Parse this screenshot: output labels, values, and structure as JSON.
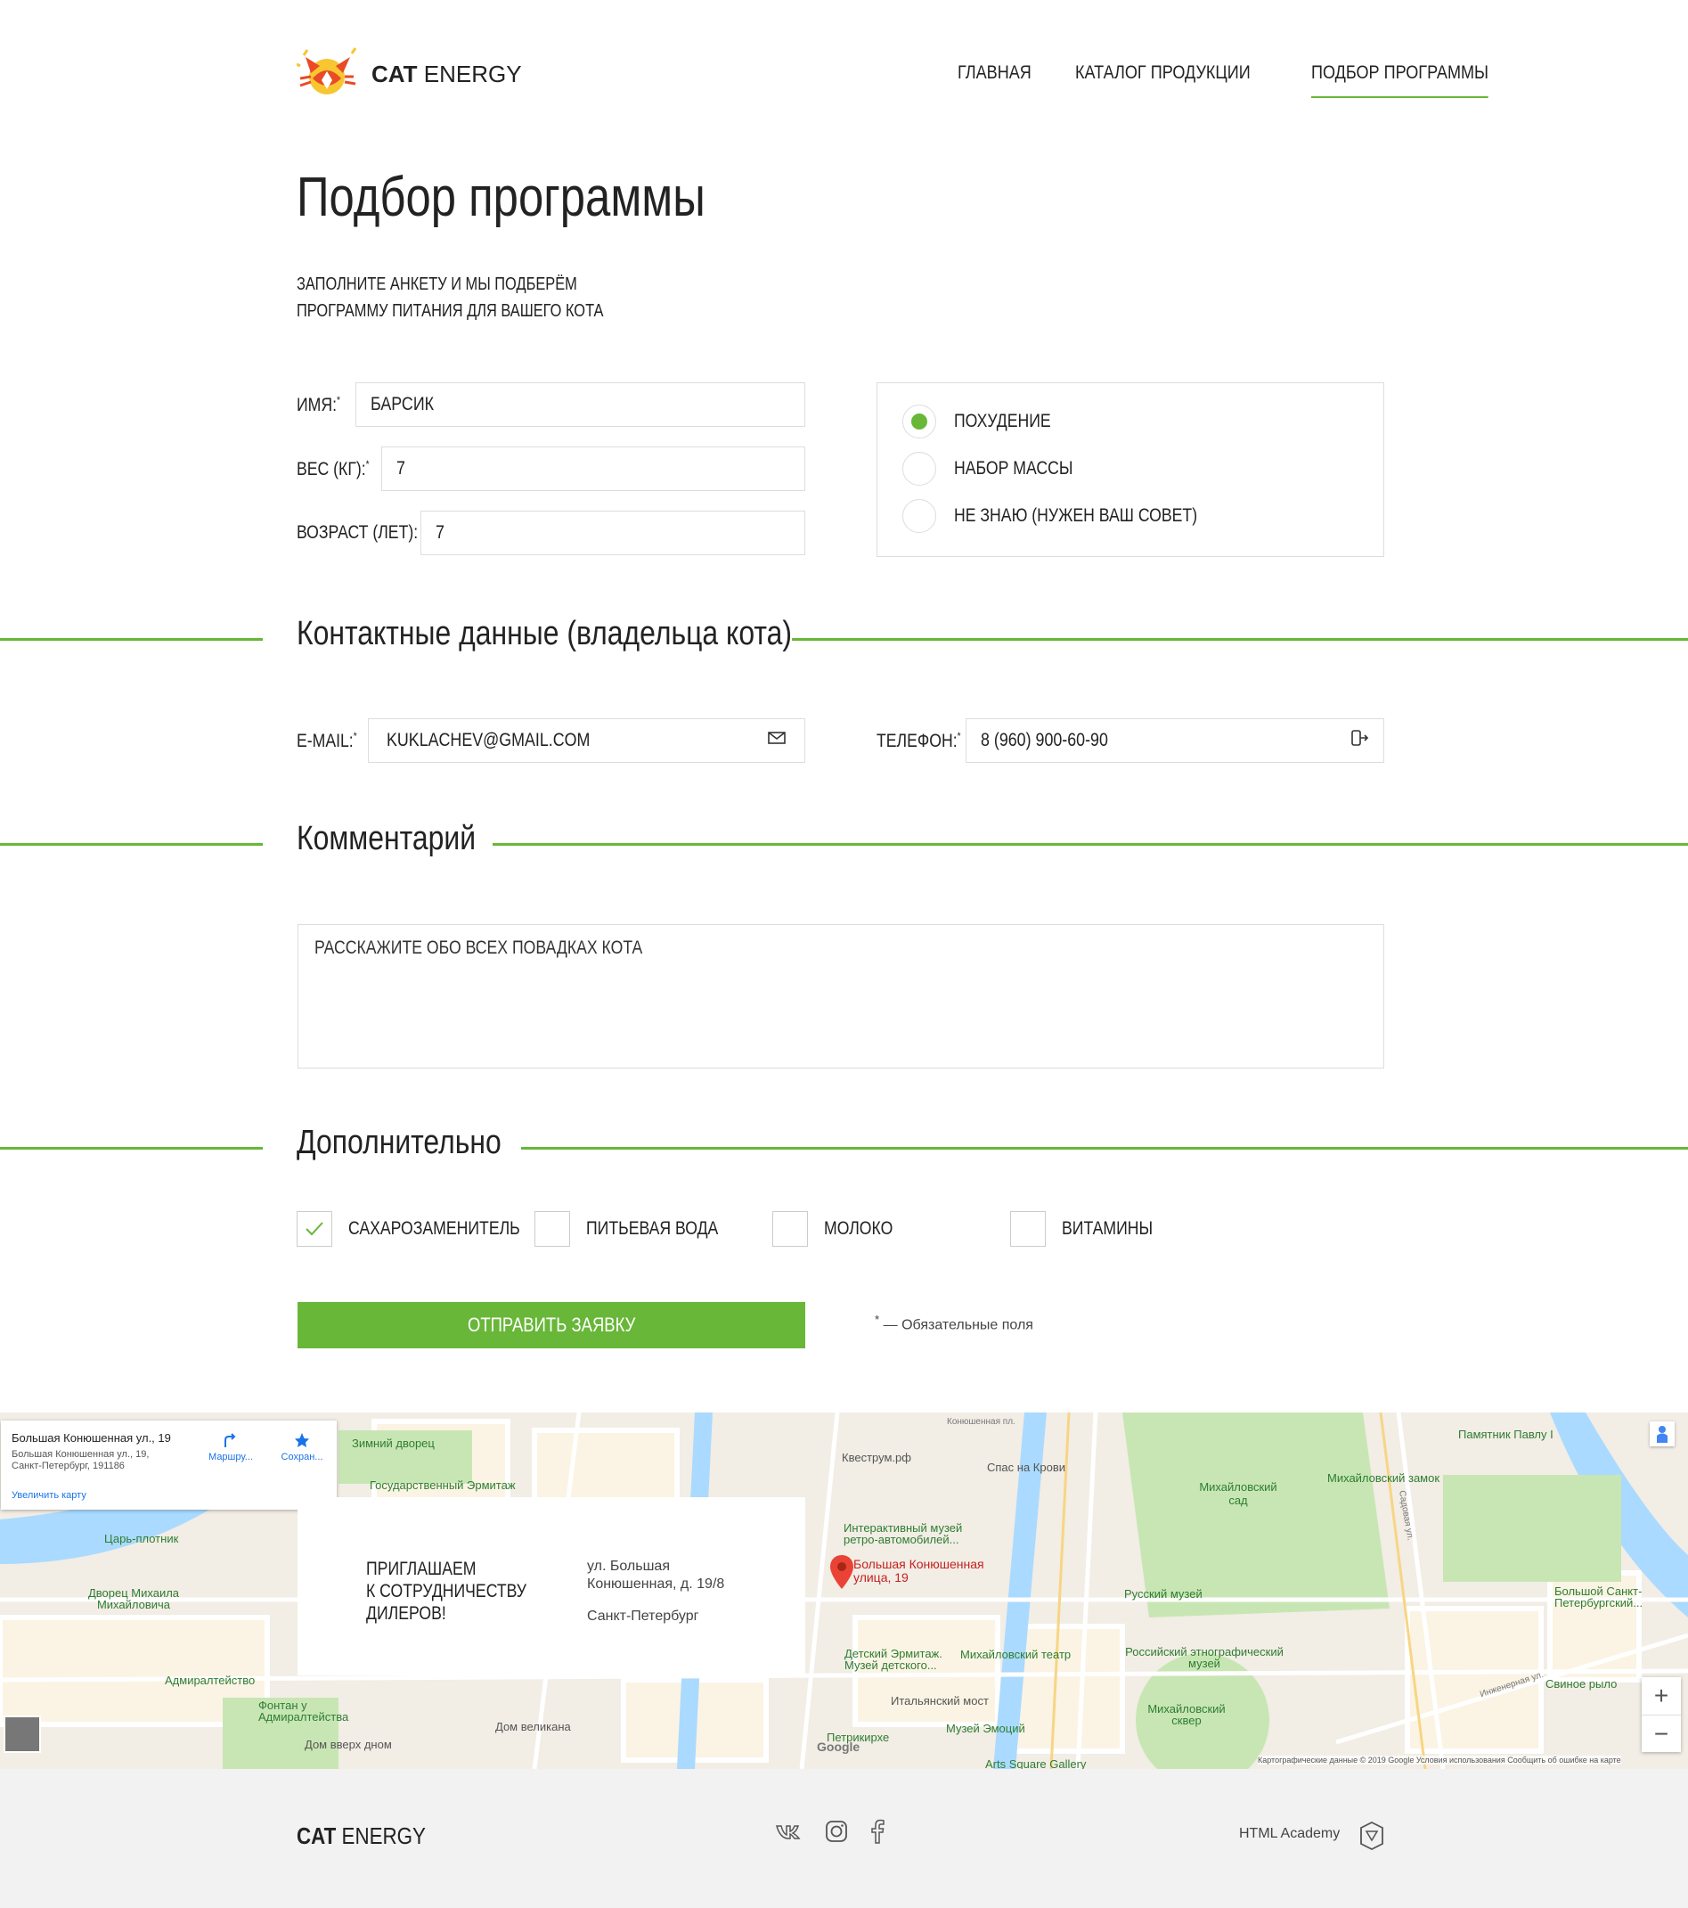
{
  "header": {
    "logo_bold": "CAT",
    "logo_light": "ENERGY",
    "nav": [
      {
        "label": "Главная"
      },
      {
        "label": "Каталог продукции"
      },
      {
        "label": "Подбор программы"
      }
    ]
  },
  "page": {
    "title": "Подбор программы",
    "intro_line1": "Заполните анкету и мы подберём",
    "intro_line2": "программу питания для вашего кота"
  },
  "form": {
    "name_label": "Имя:",
    "name_value": "Барсик",
    "weight_label": "Вес (кг):",
    "weight_value": "7",
    "age_label": "Возраст (лет):",
    "age_value": "7",
    "required_mark": "*",
    "goals": [
      {
        "label": "Похудение",
        "checked": true
      },
      {
        "label": "Набор массы",
        "checked": false
      },
      {
        "label": "Не знаю (нужен ваш совет)",
        "checked": false
      }
    ],
    "contacts_title": "Контактные данные (владельца кота)",
    "email_label": "E-mail:",
    "email_value": "kuklachev@gmail.com",
    "phone_label": "Телефон:",
    "phone_value": "8 (960) 900-60-90",
    "comment_title": "Комментарий",
    "comment_placeholder": "Расскажите обо всех повадках кота",
    "extra_title": "Дополнительно",
    "extras": [
      {
        "label": "Сахарозаменитель",
        "checked": true
      },
      {
        "label": "Питьевая вода",
        "checked": false
      },
      {
        "label": "Молоко",
        "checked": false
      },
      {
        "label": "Витамины",
        "checked": false
      }
    ],
    "submit_label": "Отправить заявку",
    "required_note_mark": "*",
    "required_note": "— Обязательные поля"
  },
  "map": {
    "card_title": "Большая Конюшенная ул., 19",
    "card_address1": "Большая Конюшенная ул., 19,",
    "card_address2": "Санкт-Петербург, 191186",
    "card_enlarge": "Увеличить карту",
    "card_route": "Маршру...",
    "card_save": "Сохран...",
    "pin_label": "Большая Конюшенная улица, 19",
    "labels": [
      "Зимний дворец",
      "Государственный Эрмитаж",
      "Царь-плотник",
      "Дворец Михаила Михайловича",
      "Адмиралтейство",
      "Фонтан у Адмиралтейства",
      "Дом вверх дном",
      "Дом великана",
      "Квеструм.рф",
      "Спас на Крови",
      "Михайловский сад",
      "Михайловский замок",
      "Памятник Павлу I",
      "Интерактивный музей ретро-автомобилей...",
      "Русский музей",
      "Детский Эрмитаж. Музей детского...",
      "Михайловский театр",
      "Российский этнографический музей",
      "Итальянский мост",
      "Музей Эмоций",
      "Михайловский сквер",
      "Петрикирхе",
      "Arts Square Gallery",
      "Большой Санкт-Петербургский...",
      "Свиное рыло",
      "Конюшенная пл.",
      "Садовая ул.",
      "Инженерная ул."
    ],
    "copyright": "Картографические данные © 2019 Google   Условия использования   Сообщить об ошибке на карте",
    "google": "Google",
    "zoom_in": "+",
    "zoom_out": "−"
  },
  "dealer": {
    "line1": "Приглашаем",
    "line2": "к сотрудничеству",
    "line3": "дилеров!",
    "address1": "ул. Большая",
    "address2": "Конюшенная, д. 19/8",
    "city": "Санкт-Петербург"
  },
  "footer": {
    "logo_bold": "CAT",
    "logo_light": "ENERGY",
    "academy": "HTML Academy"
  },
  "colors": {
    "accent": "#68b738",
    "water": "#aadaff",
    "park": "#c8e6b4"
  }
}
